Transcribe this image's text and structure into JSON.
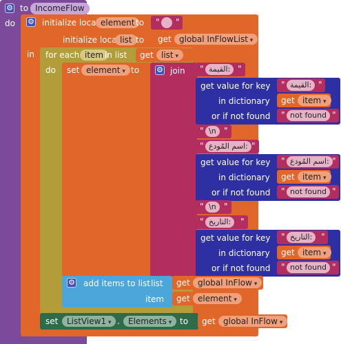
{
  "procedure": {
    "keyword_to": "to",
    "name": "IncomeFlow",
    "keyword_do": "do"
  },
  "local_block": {
    "title": "initialize local",
    "var1": "element",
    "to1": "to",
    "title2": "initialize local",
    "var2": "list",
    "to2": "to",
    "in_label": "in"
  },
  "empty_string_value": "",
  "global_get": {
    "get": "get",
    "var": "global InFlowList"
  },
  "for_each": {
    "label": "for each",
    "var": "item",
    "in_list": "in list",
    "get": "get",
    "get_var": "list",
    "do_label": "do"
  },
  "set_block": {
    "label": "set",
    "var": "element",
    "to": "to"
  },
  "join_label": "join",
  "lookup": {
    "get_value": "get value for key",
    "in_dict": "in dictionary",
    "if_not_found": "or if not found"
  },
  "strings": {
    "value_label": "القيمة:",
    "newline": "\\n",
    "depositor_label": "اسم المُودع:",
    "date_label": "التاريخ:",
    "not_found": "not found"
  },
  "item_get": {
    "get": "get",
    "var": "item"
  },
  "add_items": {
    "label": "add items to list",
    "list_label": "list",
    "item_label": "item",
    "get": "get",
    "list_var": "global InFlow",
    "item_var": "element"
  },
  "set_listview": {
    "set": "set",
    "component": "ListView1",
    "dot": ".",
    "property": "Elements",
    "to": "to",
    "get": "get",
    "var": "global InFlow"
  },
  "colors": {
    "procedure": "#7b4a9b",
    "variable": "#e0662a",
    "control": "#b29d3a",
    "text": "#b32d5e",
    "dictionary": "#2d2fa3",
    "list": "#4da6d9",
    "component": "#2f6b4a"
  },
  "icons": {
    "mutator": "gear-icon"
  }
}
